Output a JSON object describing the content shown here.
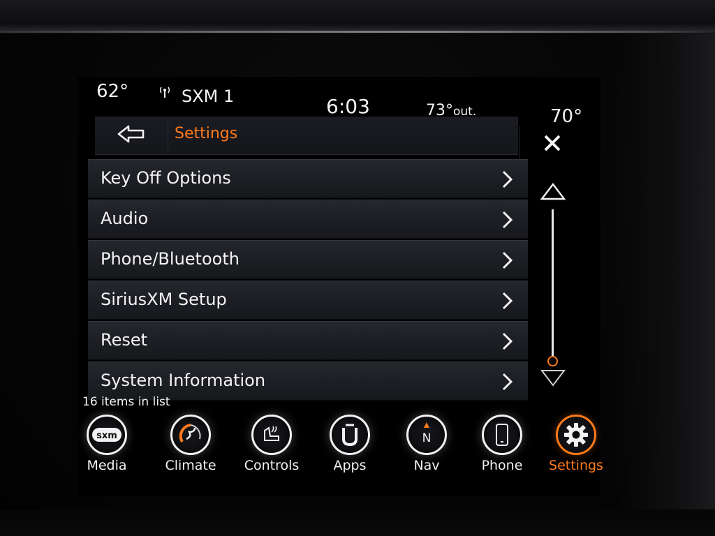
{
  "status": {
    "temp_left": "62°",
    "radio_icon": "radio-signal-icon",
    "station": "SXM 1",
    "clock": "6:03",
    "outside_temp": "73°",
    "outside_suffix": "out.",
    "temp_right": "70°"
  },
  "header": {
    "title": "Settings",
    "back_icon": "back-arrow-icon",
    "close_icon": "close-icon"
  },
  "list": {
    "items": [
      {
        "label": "Key Off Options"
      },
      {
        "label": "Audio"
      },
      {
        "label": "Phone/Bluetooth"
      },
      {
        "label": "SiriusXM Setup"
      },
      {
        "label": "Reset"
      },
      {
        "label": "System Information"
      }
    ],
    "count_text": "16 items in list",
    "scroll_position": 1.0
  },
  "nav": {
    "items": [
      {
        "label": "Media",
        "icon": "sxm-icon",
        "glyph": "sxm"
      },
      {
        "label": "Climate",
        "icon": "climate-icon",
        "glyph": "✇"
      },
      {
        "label": "Controls",
        "icon": "controls-icon",
        "glyph": "⚙"
      },
      {
        "label": "Apps",
        "icon": "apps-icon",
        "glyph": "û"
      },
      {
        "label": "Nav",
        "icon": "compass-icon",
        "glyph": "N"
      },
      {
        "label": "Phone",
        "icon": "phone-icon",
        "glyph": "▯"
      },
      {
        "label": "Settings",
        "icon": "settings-gear-icon",
        "glyph": "⚙"
      }
    ],
    "active": "Settings"
  },
  "colors": {
    "accent": "#ff7a1a",
    "text": "#f2f2f2",
    "row_bg": "#1e2025"
  }
}
